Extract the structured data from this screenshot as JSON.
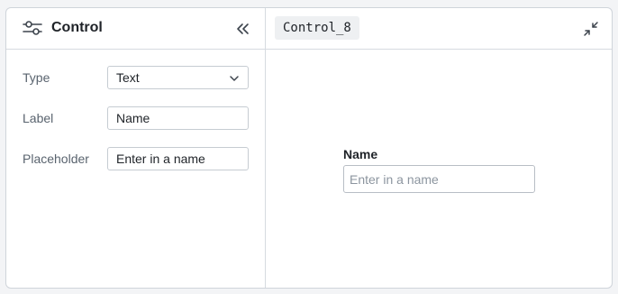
{
  "left_panel": {
    "title": "Control",
    "title_icon": "sliders-icon",
    "collapse_icon": "chevrons-left-icon",
    "fields": {
      "type": {
        "label": "Type",
        "value": "Text",
        "icon": "chevron-down-icon"
      },
      "label": {
        "label": "Label",
        "value": "Name"
      },
      "placeholder": {
        "label": "Placeholder",
        "value": "Enter in a name"
      }
    }
  },
  "right_panel": {
    "control_id": "Control_8",
    "expand_icon": "collapse-arrows-icon",
    "preview": {
      "label": "Name",
      "placeholder": "Enter in a name"
    }
  },
  "colors": {
    "border": "#cfd4da",
    "chip_bg": "#eef0f2",
    "label_muted": "#59636e"
  }
}
